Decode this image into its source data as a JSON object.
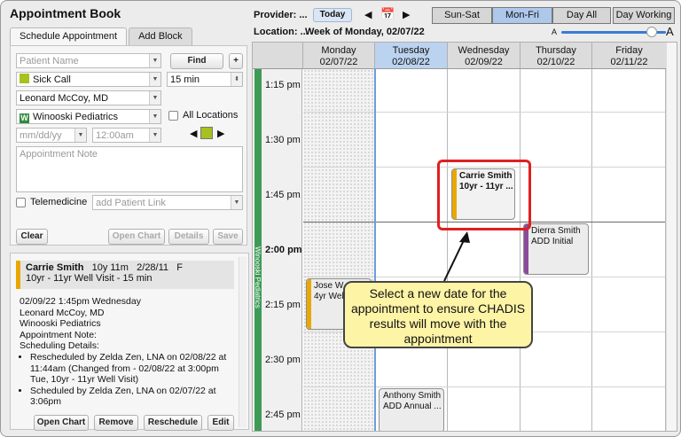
{
  "app_title": "Appointment Book",
  "tabs": [
    "Schedule Appointment",
    "Add Block"
  ],
  "form": {
    "patient_placeholder": "Patient Name",
    "find_label": "Find",
    "plus_label": "+",
    "visit_type": "Sick Call",
    "duration": "15 min",
    "provider": "Leonard McCoy, MD",
    "location": "Winooski Pediatrics",
    "location_badge": "W",
    "all_locations_label": "All Locations",
    "date_placeholder": "mm/dd/yy",
    "time_value": "12:00am",
    "note_placeholder": "Appointment Note",
    "telemedicine_label": "Telemedicine",
    "patient_link_placeholder": "add Patient Link",
    "clear_label": "Clear",
    "open_chart_label": "Open Chart",
    "details_label": "Details",
    "save_label": "Save"
  },
  "detail": {
    "name": "Carrie Smith",
    "age": "10y 11m",
    "dob": "2/28/11",
    "sex": "F",
    "visit": "10yr - 11yr Well Visit - 15 min",
    "lines": [
      "02/09/22 1:45pm Wednesday",
      "Leonard McCoy, MD",
      "Winooski Pediatrics",
      "Appointment Note:",
      "Scheduling Details:"
    ],
    "bullets": [
      "Rescheduled by Zelda Zen, LNA on 02/08/22 at 11:44am (Changed from - 02/08/22 at 3:00pm Tue, 10yr - 11yr Well Visit)",
      "Scheduled by Zelda Zen, LNA on 02/07/22 at 3:06pm"
    ],
    "buttons": {
      "open_chart": "Open Chart",
      "remove": "Remove",
      "reschedule": "Reschedule",
      "edit": "Edit"
    }
  },
  "toolbar": {
    "provider_label": "Provider: ...",
    "location_label": "Location: ...",
    "today_label": "Today",
    "week_label": "Week of Monday, 02/07/22",
    "views": [
      "Sun-Sat",
      "Mon-Fri",
      "Day All",
      "Day Working"
    ],
    "selected_view": "Mon-Fri",
    "zoom_small": "A",
    "zoom_large": "A",
    "zoom_level": 0.8
  },
  "calendar": {
    "days": [
      {
        "name": "Monday",
        "date": "02/07/22"
      },
      {
        "name": "Tuesday",
        "date": "02/08/22"
      },
      {
        "name": "Wednesday",
        "date": "02/09/22"
      },
      {
        "name": "Thursday",
        "date": "02/10/22"
      },
      {
        "name": "Friday",
        "date": "02/11/22"
      }
    ],
    "times": [
      "1:15 pm",
      "1:30 pm",
      "1:45 pm",
      "2:00 pm",
      "2:15 pm",
      "2:30 pm",
      "2:45 pm"
    ],
    "location_strip": "Winooski Pediatrics",
    "appointments": [
      {
        "name": "Carrie Smith",
        "detail": "10yr - 11yr ...",
        "color": "#e8a800"
      },
      {
        "name": "Dierra Smith",
        "detail": "ADD Initial",
        "color": "#8b4a9c"
      },
      {
        "name": "Jose W",
        "detail": "4yr Wel",
        "color": "#e8a800"
      },
      {
        "name": "Anthony Smith",
        "detail": "ADD Annual ...",
        "color": "#cfcfcf"
      }
    ]
  },
  "callout": "Select a new date for the appointment to ensure CHADIS results will move with the appointment",
  "colors": {
    "visit_swatch": "#a8c020",
    "location_badge": "#2f8a3e",
    "highlight": "#e02020",
    "callout_bg": "#fdf4a6"
  }
}
